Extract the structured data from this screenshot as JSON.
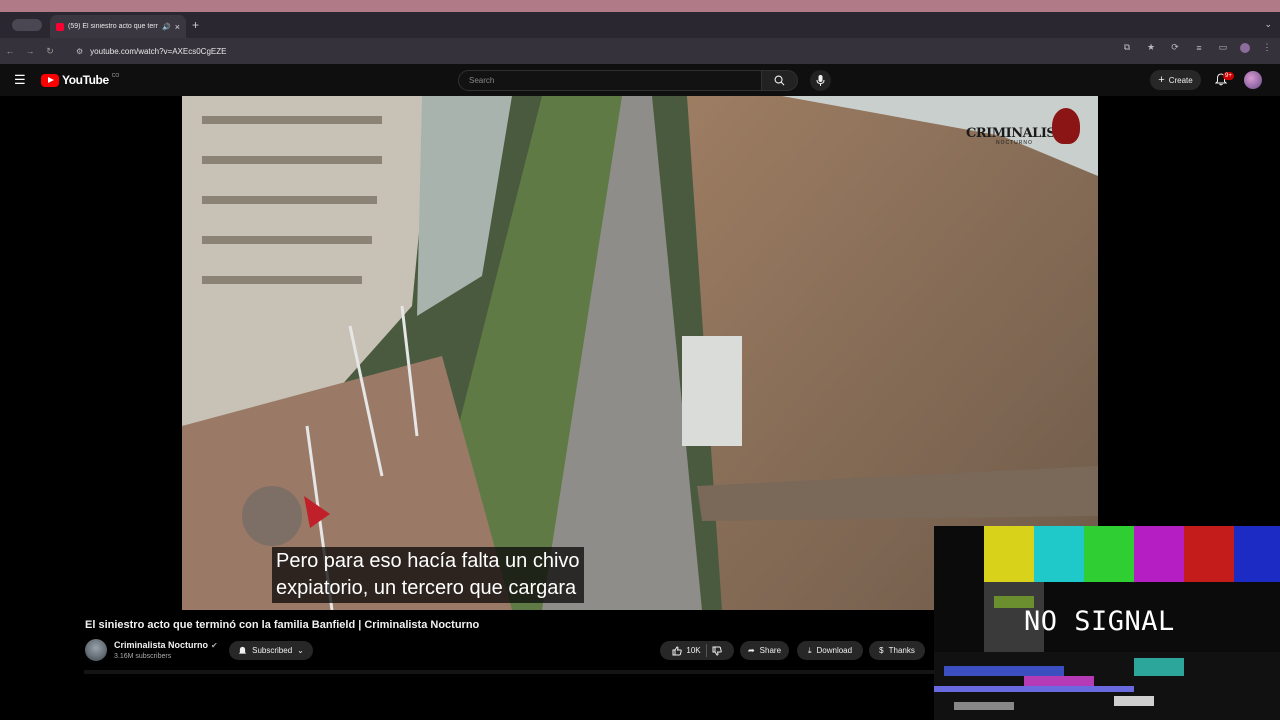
{
  "browser": {
    "tab_title": "(59) El siniestro acto que terminó con la familia Banfield | Criminalista Nocturno",
    "url": "youtube.com/watch?v=AXEcs0CgEZE"
  },
  "youtube": {
    "logo_text": "YouTube",
    "country_code": "CO",
    "search_placeholder": "Search",
    "create_label": "Create",
    "notification_count": "9+"
  },
  "video": {
    "watermark": "CRIMINALISTA",
    "watermark_sub": "NOCTURNO",
    "caption_line1": "Pero para eso hacía falta un chivo",
    "caption_line2": "expiatorio, un tercero que cargara",
    "title": "El siniestro acto que terminó con la familia Banfield | Criminalista Nocturno"
  },
  "channel": {
    "name": "Criminalista Nocturno",
    "subscribers": "3.16M subscribers",
    "subscribed_label": "Subscribed"
  },
  "actions": {
    "likes": "10K",
    "share": "Share",
    "download": "Download",
    "thanks": "Thanks"
  },
  "overlay": {
    "no_signal": "NO SIGNAL"
  }
}
